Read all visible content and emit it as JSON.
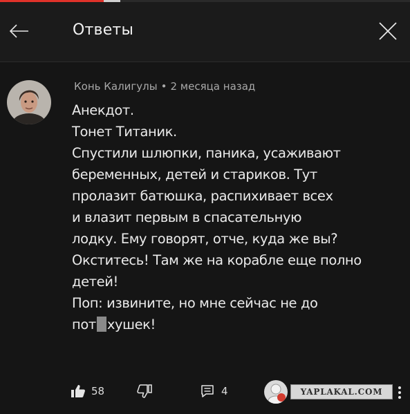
{
  "header": {
    "title": "Ответы",
    "back_icon": "arrow-left-icon",
    "close_icon": "close-icon"
  },
  "top_progress": 0.26,
  "comment": {
    "author": "Конь Калигулы",
    "separator": "•",
    "time": "2 месяца назад",
    "lines": [
      "Анекдот.",
      "Тонет Титаник.",
      "Спустили шлюпки, паника, усаживают",
      "беременных, детей и стариков. Тут",
      "пролазит батюшка, распихивает всех",
      "и влазит первым в спасательную",
      "лодку. Ему говорят, отче, куда же вы?",
      "Окститесь! Там же на корабле еще полно",
      "детей!",
      "Поп: извините, но мне сейчас не до"
    ],
    "last_line_start": "пот",
    "last_line_end": "хушек!",
    "likes": "58",
    "replies": "4"
  },
  "watermark": "YAPLAKAL.COM",
  "colors": {
    "background": "#151515",
    "header": "#1b1b1b",
    "text": "#eaeaea",
    "meta": "#a9a9a9",
    "accent": "#e0322a"
  }
}
